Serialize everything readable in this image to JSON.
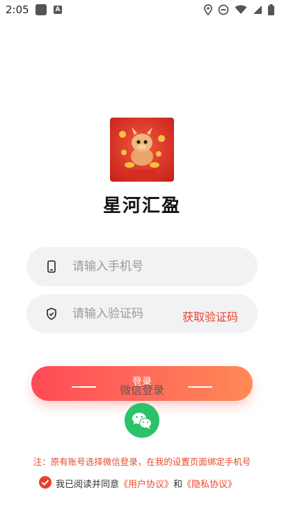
{
  "status_bar": {
    "time": "2:05",
    "notification_icons": [
      "square-app-icon",
      "a-app-icon"
    ],
    "system_icons": [
      "location-icon",
      "dnd-icon",
      "wifi-icon",
      "signal-icon",
      "battery-icon"
    ]
  },
  "app": {
    "logo_icon": "dragon-logo-icon",
    "logo_text": "星河汇盈",
    "name": "星河汇盈"
  },
  "form": {
    "phone_placeholder": "请输入手机号",
    "phone_icon": "phone-icon",
    "code_placeholder": "请输入验证码",
    "code_icon": "shield-icon",
    "get_code_label": "获取验证码"
  },
  "login_button": {
    "label": "登录"
  },
  "wechat": {
    "divider_label": "微信登录",
    "icon": "wechat-icon"
  },
  "notice": "注：原有账号选择微信登录，在我的设置页面绑定手机号",
  "agreement": {
    "prefix": "我已阅读并同意",
    "user_agreement": "《用户协议》",
    "and": "和",
    "privacy_agreement": "《隐私协议》",
    "checked": true
  },
  "colors": {
    "accent": "#e8412b",
    "wechat_green": "#2bc26a",
    "field_bg": "#f2f2f4",
    "button_gradient_start": "#ff4a57",
    "button_gradient_end": "#ff8a55"
  }
}
